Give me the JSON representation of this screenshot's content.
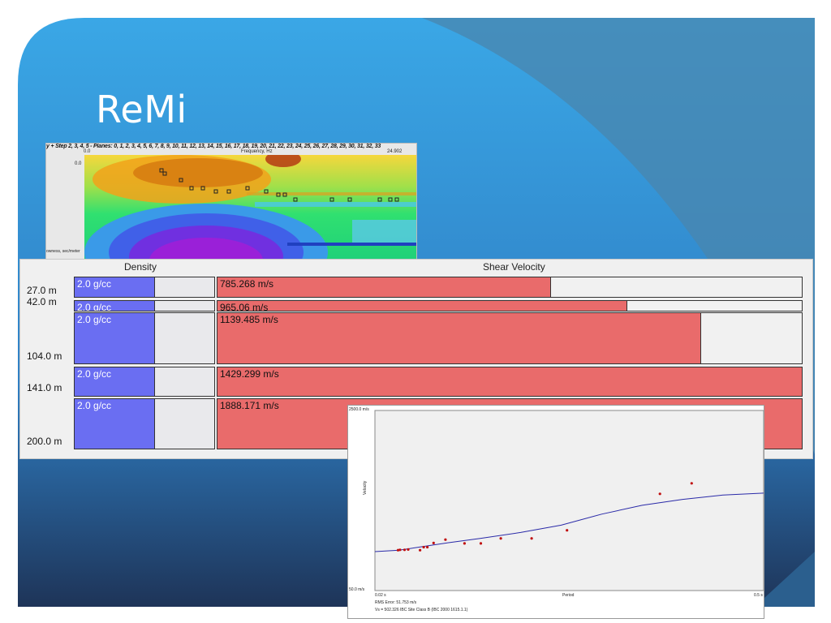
{
  "slide": {
    "title": "ReMi",
    "colors": {
      "bg_dark": "#1e3458",
      "bg_mid": "#2f7fc4",
      "bg_light": "#3aa7e6",
      "outer": "#4a86ae"
    }
  },
  "spectrogram": {
    "title": "y + Step 2, 3, 4, 5 - Planes: 0, 1, 2, 3, 4, 5, 6, 7, 8, 9, 10, 11, 12, 13, 14, 15, 16, 17, 18, 19, 20, 21, 22, 23, 24, 25, 26, 27, 28, 29, 30, 31, 32, 33",
    "frequency_label": "Frequency, Hz",
    "tick_left": "0.0",
    "tick_right": "24.902",
    "y_tick": "0.0",
    "y_axis_label": "owness, sec/meter"
  },
  "layers": {
    "density_header": "Density",
    "velocity_header": "Shear Velocity",
    "velocity_max": 1380,
    "colors": {
      "density": "#6a6ef2",
      "velocity": "#e96b6b"
    },
    "rows": [
      {
        "depth": "27.0 m",
        "density": "2.0 g/cc",
        "velocity": "785.268 m/s",
        "velocity_value": 785.268
      },
      {
        "depth": "42.0 m",
        "density": "2.0 g/cc",
        "velocity": "965.06 m/s",
        "velocity_value": 965.06
      },
      {
        "depth": "104.0 m",
        "density": "2.0 g/cc",
        "velocity": "1139.485 m/s",
        "velocity_value": 1139.485
      },
      {
        "depth": "141.0 m",
        "density": "2.0 g/cc",
        "velocity": "1429.299 m/s",
        "velocity_value": 1429.299
      },
      {
        "depth": "200.0 m",
        "density": "2.0 g/cc",
        "velocity": "1888.171 m/s",
        "velocity_value": 1888.171
      }
    ]
  },
  "chart_data": {
    "type": "scatter",
    "ylabel": "Velocity",
    "xlabel": "Period",
    "y_top_label": "2500.0 m/s",
    "y_bottom_label": "50.0 m/s",
    "x_left_label": "0.02 s",
    "x_right_label": "0.5 s",
    "xlim": [
      0.02,
      0.5
    ],
    "ylim": [
      50,
      2500
    ],
    "points": [
      {
        "x": 0.0486,
        "y": 600
      },
      {
        "x": 0.051,
        "y": 604
      },
      {
        "x": 0.0566,
        "y": 604
      },
      {
        "x": 0.0611,
        "y": 608
      },
      {
        "x": 0.0757,
        "y": 600
      },
      {
        "x": 0.0802,
        "y": 640
      },
      {
        "x": 0.0847,
        "y": 640
      },
      {
        "x": 0.0925,
        "y": 697
      },
      {
        "x": 0.1071,
        "y": 743
      },
      {
        "x": 0.1306,
        "y": 691
      },
      {
        "x": 0.1508,
        "y": 691
      },
      {
        "x": 0.1754,
        "y": 760
      },
      {
        "x": 0.2135,
        "y": 760
      },
      {
        "x": 0.2572,
        "y": 870
      },
      {
        "x": 0.3719,
        "y": 1366
      },
      {
        "x": 0.4111,
        "y": 1509
      }
    ],
    "curve": [
      {
        "x": 0.02,
        "y": 580
      },
      {
        "x": 0.05,
        "y": 600
      },
      {
        "x": 0.08,
        "y": 650
      },
      {
        "x": 0.11,
        "y": 700
      },
      {
        "x": 0.15,
        "y": 760
      },
      {
        "x": 0.2,
        "y": 840
      },
      {
        "x": 0.25,
        "y": 940
      },
      {
        "x": 0.3,
        "y": 1090
      },
      {
        "x": 0.35,
        "y": 1210
      },
      {
        "x": 0.4,
        "y": 1290
      },
      {
        "x": 0.45,
        "y": 1350
      },
      {
        "x": 0.5,
        "y": 1375
      }
    ],
    "footer_rms": "RMS Error: 51.753 m/s",
    "footer_vs": "Vs = 502.326    IBC Site Class B (IBC 2000 1615.1.1)"
  }
}
